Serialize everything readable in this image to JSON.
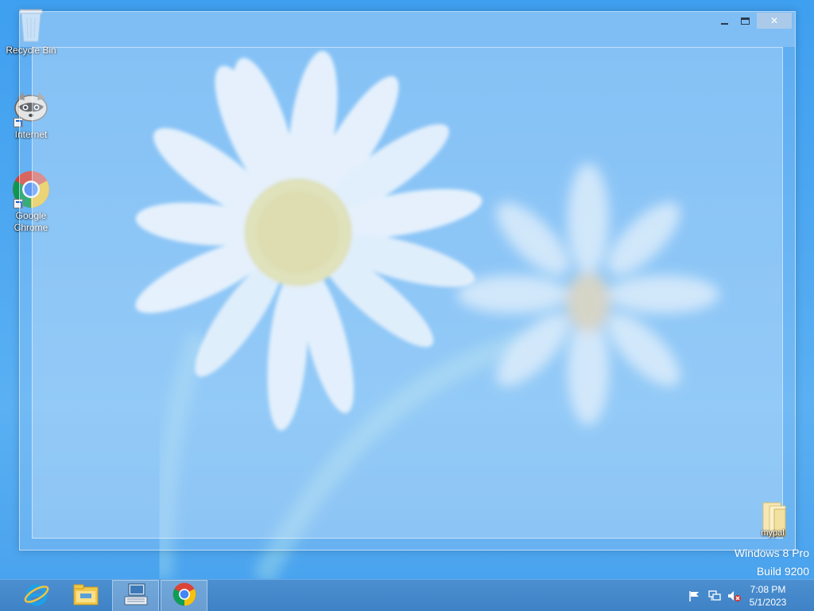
{
  "desktop": {
    "icons": [
      {
        "label": "Recycle Bin",
        "icon": "recycle-bin-icon"
      },
      {
        "label": "Internet",
        "icon": "raccoon-browser-icon"
      },
      {
        "label": "Google Chrome",
        "icon": "chrome-icon"
      },
      {
        "label": "mypal",
        "icon": "folder-icon"
      }
    ],
    "watermark": {
      "line1": "Windows 8 Pro",
      "line2": "Build 9200"
    }
  },
  "window": {
    "buttons": {
      "minimize": "minimize",
      "maximize": "maximize",
      "close": "✕"
    }
  },
  "taskbar": {
    "apps": [
      {
        "name": "Internet Explorer",
        "icon": "ie-icon"
      },
      {
        "name": "File Explorer",
        "icon": "folder-icon"
      },
      {
        "name": "On-Screen Keyboard",
        "icon": "keyboard-icon",
        "active": true
      },
      {
        "name": "Google Chrome",
        "icon": "chrome-icon",
        "active": true
      }
    ],
    "tray": [
      "action-center-flag-icon",
      "network-icon",
      "volume-muted-icon"
    ],
    "clock": {
      "time": "7:08 PM",
      "date": "5/1/2023"
    }
  },
  "colors": {
    "wallpaper": "#4ea8f1",
    "taskbar": "#4388cb",
    "chrome_red": "#db4437",
    "chrome_yellow": "#f4c20d",
    "chrome_green": "#0f9d58",
    "chrome_blue": "#4285f4"
  }
}
